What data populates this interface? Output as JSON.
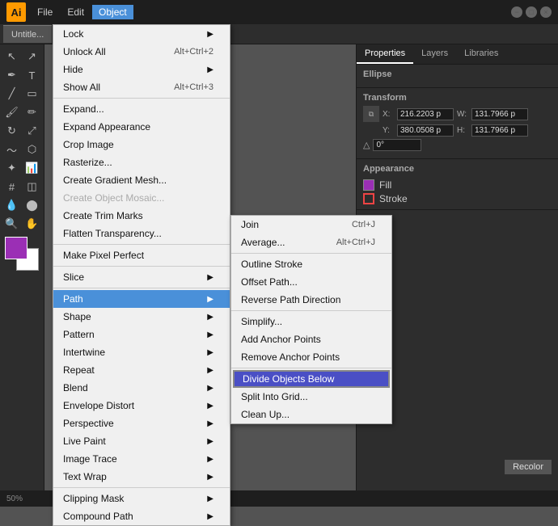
{
  "titleBar": {
    "logo": "Ai",
    "menuItems": [
      "File",
      "Edit",
      "Object"
    ],
    "activeMenu": "Object",
    "docTab": "Untitle...",
    "windowButtons": [
      "−",
      "□",
      "×"
    ]
  },
  "objectMenu": {
    "items": [
      {
        "label": "Lock",
        "shortcut": "",
        "hasArrow": true,
        "disabled": false,
        "separator": false
      },
      {
        "label": "Unlock All",
        "shortcut": "Alt+Ctrl+2",
        "hasArrow": false,
        "disabled": false,
        "separator": false
      },
      {
        "label": "Hide",
        "shortcut": "",
        "hasArrow": true,
        "disabled": false,
        "separator": false
      },
      {
        "label": "Show All",
        "shortcut": "Alt+Ctrl+3",
        "hasArrow": false,
        "disabled": false,
        "separator": true
      },
      {
        "label": "Expand...",
        "shortcut": "",
        "hasArrow": false,
        "disabled": false,
        "separator": false
      },
      {
        "label": "Expand Appearance",
        "shortcut": "",
        "hasArrow": false,
        "disabled": false,
        "separator": false
      },
      {
        "label": "Crop Image",
        "shortcut": "",
        "hasArrow": false,
        "disabled": false,
        "separator": false
      },
      {
        "label": "Rasterize...",
        "shortcut": "",
        "hasArrow": false,
        "disabled": false,
        "separator": false
      },
      {
        "label": "Create Gradient Mesh...",
        "shortcut": "",
        "hasArrow": false,
        "disabled": false,
        "separator": false
      },
      {
        "label": "Create Object Mosaic...",
        "shortcut": "",
        "hasArrow": false,
        "disabled": true,
        "separator": false
      },
      {
        "label": "Create Trim Marks",
        "shortcut": "",
        "hasArrow": false,
        "disabled": false,
        "separator": false
      },
      {
        "label": "Flatten Transparency...",
        "shortcut": "",
        "hasArrow": false,
        "disabled": false,
        "separator": true
      },
      {
        "label": "Make Pixel Perfect",
        "shortcut": "",
        "hasArrow": false,
        "disabled": false,
        "separator": true
      },
      {
        "label": "Slice",
        "shortcut": "",
        "hasArrow": true,
        "disabled": false,
        "separator": true
      },
      {
        "label": "Path",
        "shortcut": "",
        "hasArrow": true,
        "disabled": false,
        "highlighted": true,
        "separator": false
      },
      {
        "label": "Shape",
        "shortcut": "",
        "hasArrow": true,
        "disabled": false,
        "separator": false
      },
      {
        "label": "Pattern",
        "shortcut": "",
        "hasArrow": true,
        "disabled": false,
        "separator": false
      },
      {
        "label": "Intertwine",
        "shortcut": "",
        "hasArrow": true,
        "disabled": false,
        "separator": false
      },
      {
        "label": "Repeat",
        "shortcut": "",
        "hasArrow": true,
        "disabled": false,
        "separator": false
      },
      {
        "label": "Blend",
        "shortcut": "",
        "hasArrow": true,
        "disabled": false,
        "separator": false
      },
      {
        "label": "Envelope Distort",
        "shortcut": "",
        "hasArrow": true,
        "disabled": false,
        "separator": false
      },
      {
        "label": "Perspective",
        "shortcut": "",
        "hasArrow": true,
        "disabled": false,
        "separator": false
      },
      {
        "label": "Live Paint",
        "shortcut": "",
        "hasArrow": true,
        "disabled": false,
        "separator": false
      },
      {
        "label": "Image Trace",
        "shortcut": "",
        "hasArrow": true,
        "disabled": false,
        "separator": false
      },
      {
        "label": "Text Wrap",
        "shortcut": "",
        "hasArrow": true,
        "disabled": false,
        "separator": true
      },
      {
        "label": "Clipping Mask",
        "shortcut": "",
        "hasArrow": true,
        "disabled": false,
        "separator": false
      },
      {
        "label": "Compound Path",
        "shortcut": "",
        "hasArrow": true,
        "disabled": false,
        "separator": false
      }
    ]
  },
  "pathSubmenu": {
    "items": [
      {
        "label": "Join",
        "shortcut": "Ctrl+J",
        "separator": false,
        "highlighted": false
      },
      {
        "label": "Average...",
        "shortcut": "Alt+Ctrl+J",
        "separator": true,
        "highlighted": false
      },
      {
        "label": "Outline Stroke",
        "shortcut": "",
        "separator": false,
        "highlighted": false
      },
      {
        "label": "Offset Path...",
        "shortcut": "",
        "separator": false,
        "highlighted": false
      },
      {
        "label": "Reverse Path Direction",
        "shortcut": "",
        "separator": true,
        "highlighted": false
      },
      {
        "label": "Simplify...",
        "shortcut": "",
        "separator": false,
        "highlighted": false
      },
      {
        "label": "Add Anchor Points",
        "shortcut": "",
        "separator": false,
        "highlighted": false
      },
      {
        "label": "Remove Anchor Points",
        "shortcut": "",
        "separator": true,
        "highlighted": false
      },
      {
        "label": "Divide Objects Below",
        "shortcut": "",
        "separator": false,
        "highlighted": true
      },
      {
        "label": "Split Into Grid...",
        "shortcut": "",
        "separator": false,
        "highlighted": false
      },
      {
        "label": "Clean Up...",
        "shortcut": "",
        "separator": false,
        "highlighted": false
      }
    ]
  },
  "rightPanel": {
    "tabs": [
      "Properties",
      "Layers",
      "Libraries"
    ],
    "activeTab": "Properties",
    "objectType": "Ellipse",
    "transform": {
      "title": "Transform",
      "x": {
        "label": "X:",
        "value": "216.2203 p"
      },
      "y": {
        "label": "Y:",
        "value": "380.0508 p"
      },
      "w": {
        "label": "W:",
        "value": "131.7966 p"
      },
      "h": {
        "label": "H:",
        "value": "131.7966 p"
      },
      "angle": "0°"
    },
    "appearance": {
      "title": "Appearance",
      "fill": "Fill",
      "stroke": "Stroke"
    },
    "recolorLabel": "Recolor"
  },
  "statusBar": {
    "zoom": "50%"
  }
}
